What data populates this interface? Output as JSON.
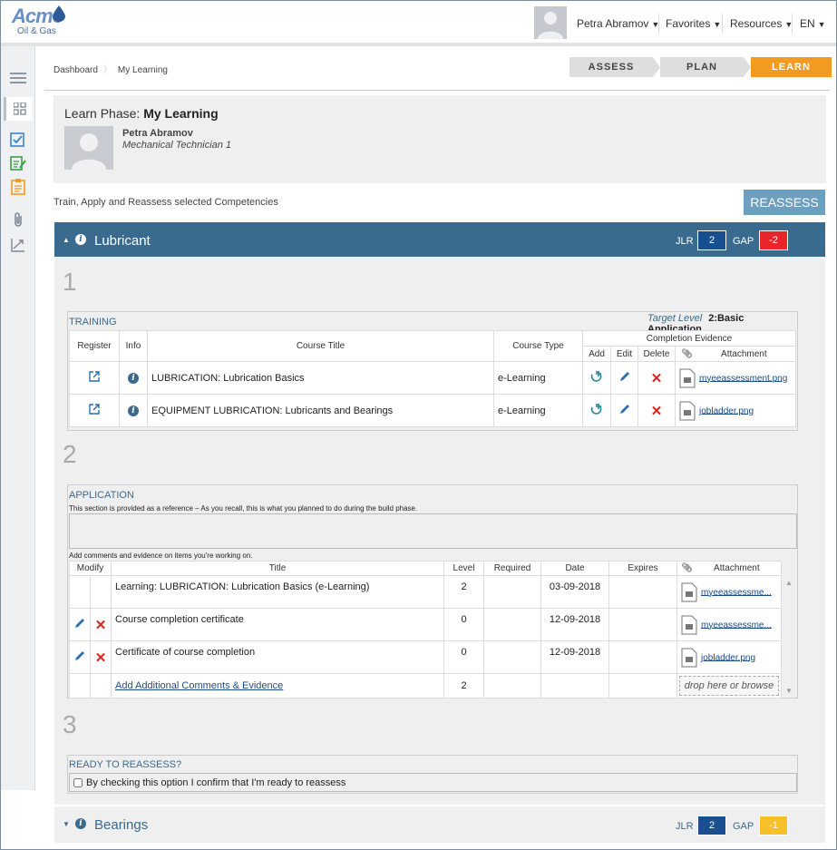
{
  "header": {
    "logo_main": "Acme",
    "logo_sub": "Oil & Gas",
    "user_name": "Petra Abramov",
    "nav": [
      "Favorites",
      "Resources",
      "EN"
    ]
  },
  "breadcrumb": [
    "Dashboard",
    "My Learning"
  ],
  "steps": [
    "ASSESS",
    "PLAN",
    "LEARN"
  ],
  "learn": {
    "phase_label": "Learn Phase:",
    "phase_name": "My Learning",
    "person_name": "Petra Abramov",
    "person_role": "Mechanical Technician 1"
  },
  "train_text": "Train, Apply and Reassess selected Competencies",
  "reassess_label": "REASSESS",
  "competency": {
    "name": "Lubricant",
    "jlr_label": "JLR",
    "jlr": "2",
    "gap_label": "GAP",
    "gap": "-2",
    "colors": {
      "header": "#3a6b8e",
      "jlr": "#1a4f8f",
      "gap": "#e8262a"
    }
  },
  "sections": [
    "1",
    "2",
    "3"
  ],
  "training": {
    "title": "TRAINING",
    "target_label": "Target Level",
    "target_value": "2:Basic Application",
    "columns": [
      "Register",
      "Info",
      "Course Title",
      "Course Type"
    ],
    "evidence_header": "Completion Evidence",
    "evidence_cols": [
      "Add",
      "Edit",
      "Delete",
      "Attachment"
    ],
    "rows": [
      {
        "title": "LUBRICATION: Lubrication Basics",
        "type": "e-Learning",
        "file": "myeeassessment.png"
      },
      {
        "title": "EQUIPMENT LUBRICATION: Lubricants and Bearings",
        "type": "e-Learning",
        "file": "jobladder.png"
      }
    ]
  },
  "application": {
    "title": "APPLICATION",
    "note": "This section is provided as a reference – As you recall, this is what you planned to do during the build phase.",
    "comment_note": "Add comments and evidence on items you're working on.",
    "columns": [
      "Modify",
      "Title",
      "Level",
      "Required",
      "Date",
      "Expires",
      "Attachment"
    ],
    "rows": [
      {
        "title": "Learning: LUBRICATION: Lubrication Basics (e-Learning)",
        "level": "2",
        "required": "",
        "date": "03-09-2018",
        "expires": "",
        "file": "myeeassessme..."
      },
      {
        "title": "Course completion certificate",
        "level": "0",
        "required": "",
        "date": "12-09-2018",
        "expires": "",
        "file": "myeeassessme..."
      },
      {
        "title": "Certificate of course completion",
        "level": "0",
        "required": "",
        "date": "12-09-2018",
        "expires": "",
        "file": "jobladder.png"
      }
    ],
    "add_link": "Add Additional Comments & Evidence",
    "add_level": "2",
    "drop_label": "drop here or browse"
  },
  "ready": {
    "title": "READY TO REASSESS?",
    "checkbox_label": "By checking this option I confirm that I'm ready to reassess"
  },
  "bearings": {
    "name": "Bearings",
    "jlr_label": "JLR",
    "jlr": "2",
    "gap_label": "GAP",
    "gap": "-1",
    "colors": {
      "jlr": "#1a4f8f",
      "gap": "#f5c02a"
    }
  }
}
